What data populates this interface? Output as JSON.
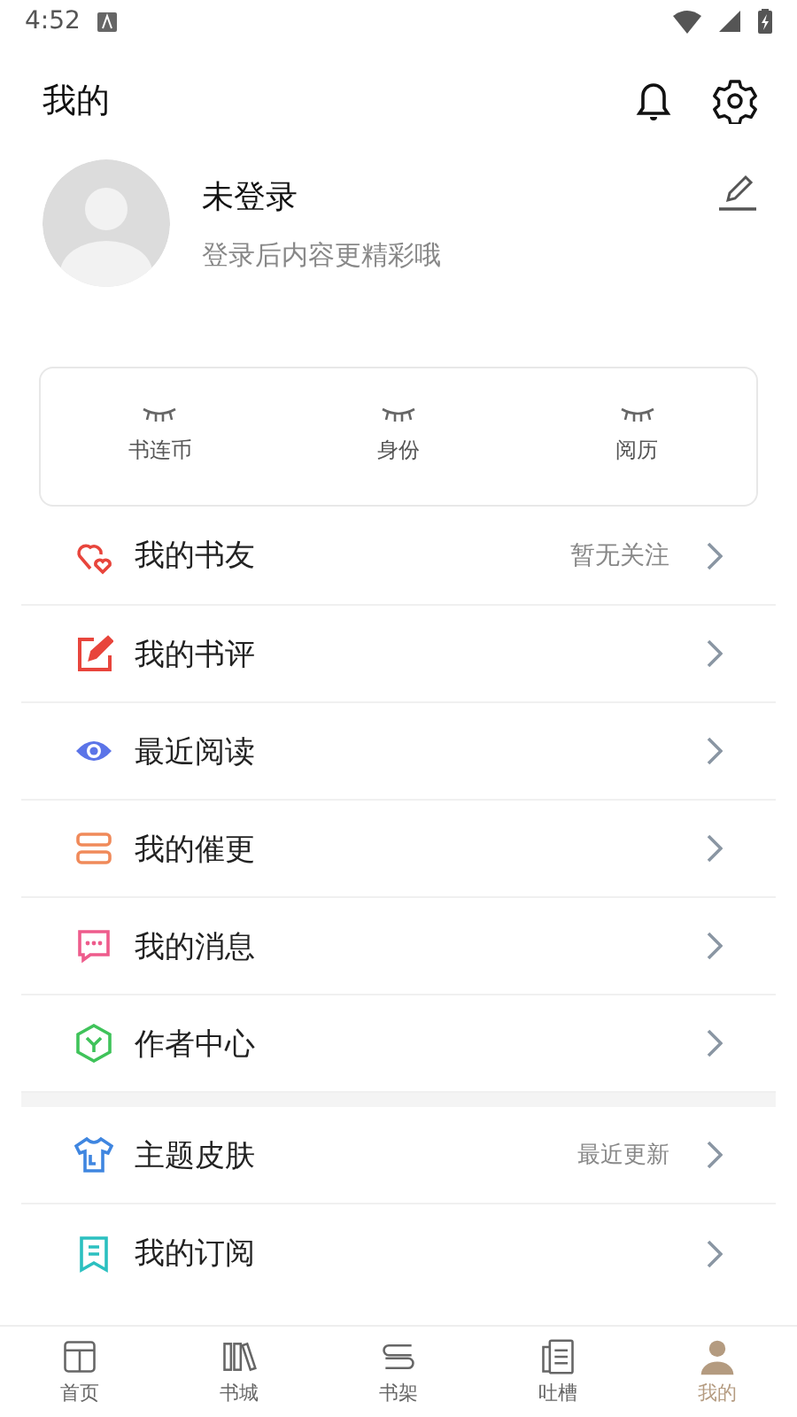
{
  "status_bar": {
    "time": "4:52"
  },
  "header": {
    "title": "我的"
  },
  "profile": {
    "name": "未登录",
    "subtitle": "登录后内容更精彩哦"
  },
  "stats": [
    {
      "label": "书连币"
    },
    {
      "label": "身份"
    },
    {
      "label": "阅历"
    }
  ],
  "menu_sections": [
    {
      "items": [
        {
          "label": "我的书友",
          "value": "暂无关注"
        },
        {
          "label": "我的书评"
        },
        {
          "label": "最近阅读"
        },
        {
          "label": "我的催更"
        },
        {
          "label": "我的消息"
        },
        {
          "label": "作者中心"
        }
      ]
    },
    {
      "items": [
        {
          "label": "主题皮肤",
          "value": "最近更新"
        },
        {
          "label": "我的订阅"
        }
      ]
    }
  ],
  "tab_bar": [
    {
      "label": "首页",
      "selected": false
    },
    {
      "label": "书城",
      "selected": false
    },
    {
      "label": "书架",
      "selected": false
    },
    {
      "label": "吐槽",
      "selected": false
    },
    {
      "label": "我的",
      "selected": true
    }
  ]
}
